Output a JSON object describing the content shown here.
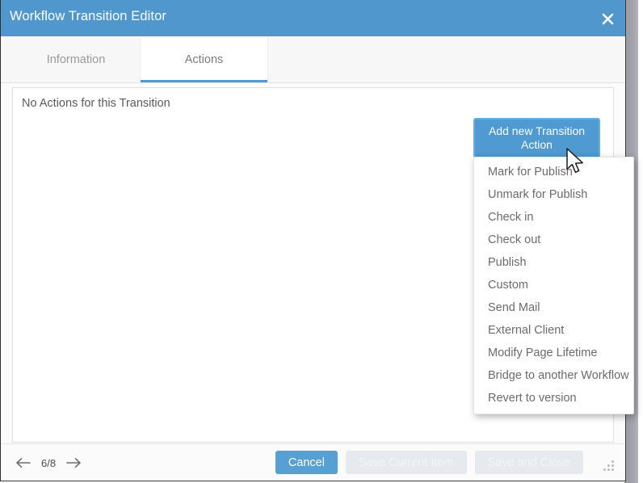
{
  "window": {
    "title": "Workflow Transition Editor",
    "close_icon": "close-x-icon"
  },
  "tabs": [
    {
      "label": "Information",
      "active": false
    },
    {
      "label": "Actions",
      "active": true
    }
  ],
  "content": {
    "empty_message": "No Actions for this Transition",
    "add_action_button": "Add new Transition Action"
  },
  "dropdown": {
    "open": true,
    "items": [
      "Mark for Publish",
      "Unmark for Publish",
      "Check in",
      "Check out",
      "Publish",
      "Custom",
      "Send Mail",
      "External Client",
      "Modify Page Lifetime",
      "Bridge to another Workflow",
      "Revert to version"
    ]
  },
  "footer": {
    "prev_icon": "arrow-left-icon",
    "next_icon": "arrow-right-icon",
    "page_counter": "6/8",
    "cancel_label": "Cancel",
    "save_current_label": "Save Current Item",
    "save_close_label": "Save and Close",
    "resize_grip_icon": "resize-grip-icon"
  },
  "colors": {
    "header_blue": "#5097cd",
    "accent_blue": "#4f9ad0",
    "button_blue": "#57a0d3",
    "disabled_gray": "#e6e9ee",
    "text_gray": "#6b6b6b"
  }
}
